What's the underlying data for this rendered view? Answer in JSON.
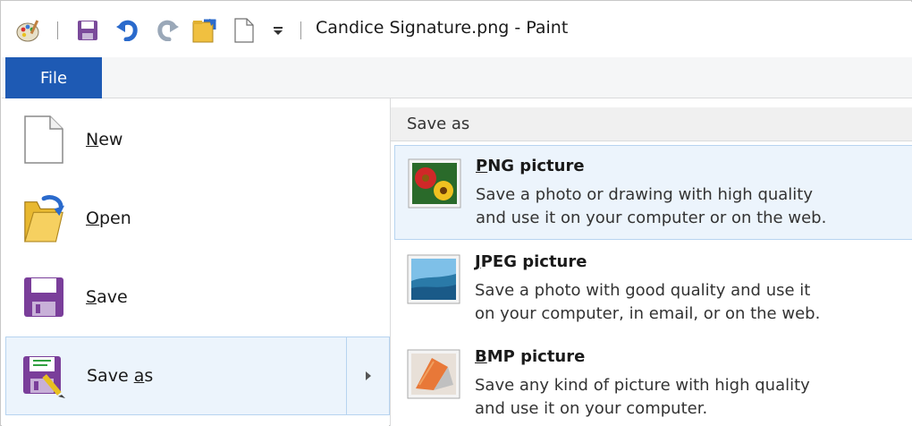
{
  "window": {
    "title": "Candice Signature.png - Paint"
  },
  "quick_access": {
    "icons": [
      "paint-palette-icon",
      "save-icon",
      "undo-icon",
      "redo-icon",
      "folder-icon",
      "new-document-icon",
      "customize-dropdown-icon"
    ]
  },
  "tabs": {
    "file_label": "File"
  },
  "file_menu": {
    "items": [
      {
        "label_pre": "",
        "label_ul": "N",
        "label_post": "ew",
        "icon": "new-document-icon"
      },
      {
        "label_pre": "",
        "label_ul": "O",
        "label_post": "pen",
        "icon": "open-folder-icon"
      },
      {
        "label_pre": "",
        "label_ul": "S",
        "label_post": "ave",
        "icon": "save-icon"
      },
      {
        "label_pre": "Save ",
        "label_ul": "a",
        "label_post": "s",
        "icon": "save-as-icon"
      }
    ]
  },
  "save_as_menu": {
    "header": "Save as",
    "items": [
      {
        "title_ul": "P",
        "title_rest": "NG picture",
        "desc1": "Save a photo or drawing with high quality",
        "desc2": "and use it on your computer or on the web.",
        "icon": "png-picture-icon"
      },
      {
        "title_ul": "J",
        "title_rest": "PEG picture",
        "desc1": "Save a photo with good quality and use it",
        "desc2": "on your computer, in email, or on the web.",
        "icon": "jpeg-picture-icon"
      },
      {
        "title_ul": "B",
        "title_rest": "MP picture",
        "desc1": "Save any kind of picture with high quality",
        "desc2": "and use it on your computer.",
        "icon": "bmp-picture-icon"
      }
    ]
  },
  "colors": {
    "accent": "#1e5ab4",
    "hover_bg": "#ecf4fc",
    "hover_border": "#b7d4f0"
  }
}
